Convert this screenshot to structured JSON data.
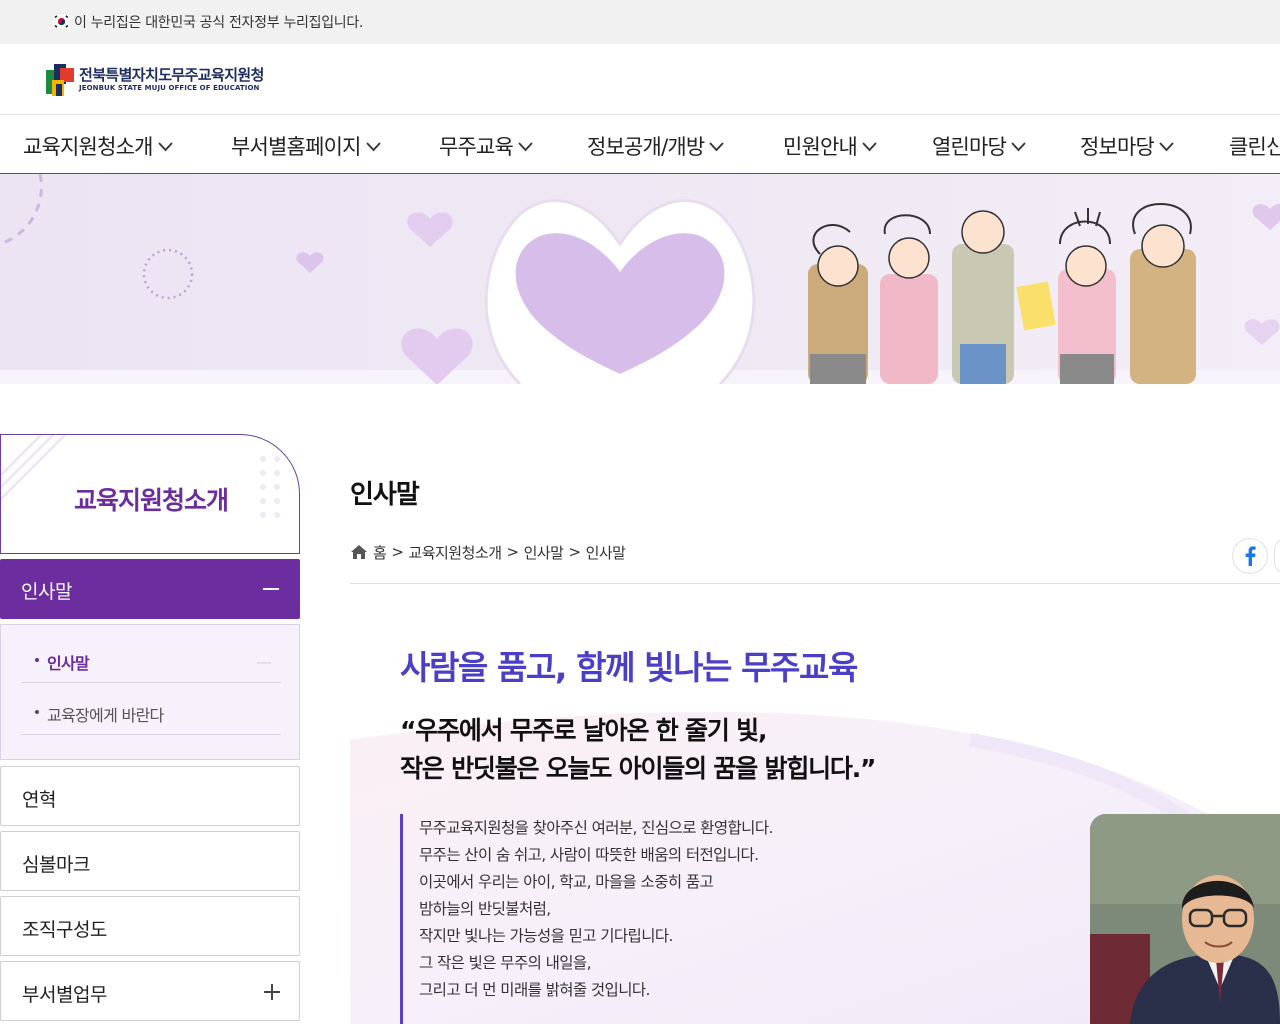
{
  "gov_notice": {
    "text": "이 누리집은 대한민국 공식 전자정부 누리집입니다."
  },
  "logo": {
    "name_ko": "전북특별자치도무주교육지원청",
    "name_en": "JEONBUK STATE MUJU OFFICE OF EDUCATION"
  },
  "gnb": {
    "items": [
      {
        "label": "교육지원청소개"
      },
      {
        "label": "부서별홈페이지"
      },
      {
        "label": "무주교육"
      },
      {
        "label": "정보공개/개방"
      },
      {
        "label": "민원안내"
      },
      {
        "label": "열린마당"
      },
      {
        "label": "정보마당"
      },
      {
        "label": "클린신"
      }
    ]
  },
  "sidebar": {
    "title": "교육지원청소개",
    "active_menu": "인사말",
    "sub_items": [
      {
        "label": "인사말"
      },
      {
        "label": "교육장에게 바란다"
      }
    ],
    "menu_items": [
      {
        "label": "연혁"
      },
      {
        "label": "심볼마크"
      },
      {
        "label": "조직구성도"
      },
      {
        "label": "부서별업무"
      }
    ]
  },
  "content": {
    "page_title": "인사말",
    "breadcrumb": [
      "홈",
      "교육지원청소개",
      "인사말",
      "인사말"
    ],
    "breadcrumb_sep": ">",
    "headline": "사람을 품고, 함께 빛나는 무주교육",
    "quote_line1": "“우주에서 무주로 날아온 한 줄기 빛,",
    "quote_line2": "작은 반딧불은 오늘도 아이들의 꿈을 밝힙니다.”",
    "body_lines": [
      "무주교육지원청을 찾아주신 여러분, 진심으로 환영합니다.",
      "무주는 산이 숨 쉬고, 사람이 따뜻한 배움의 터전입니다.",
      "이곳에서 우리는 아이, 학교, 마을을 소중히 품고",
      "밤하늘의 반딧불처럼,",
      "작지만 빛나는 가능성을 믿고 기다립니다.",
      "그 작은 빛은 무주의 내일을,",
      "그리고 더 먼 미래를 밝혀줄 것입니다."
    ]
  },
  "colors": {
    "brand_purple": "#6c2d9f",
    "headline_blue": "#4b3fc7",
    "banner_bg": "#efe9f4"
  },
  "icons": [
    "korea-flag-icon",
    "logo-mark-icon",
    "chevron-down-icon",
    "home-icon",
    "facebook-icon",
    "minus-icon",
    "plus-icon"
  ]
}
